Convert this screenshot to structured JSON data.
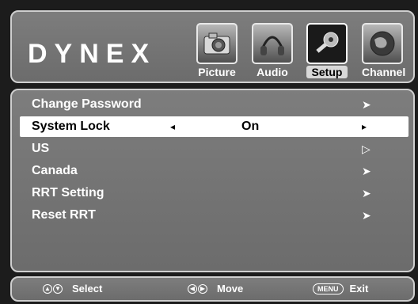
{
  "header": {
    "logo": "DYNEX",
    "tabs": [
      {
        "label": "Picture",
        "icon": "camera-icon",
        "active": false
      },
      {
        "label": "Audio",
        "icon": "headphones-icon",
        "active": false
      },
      {
        "label": "Setup",
        "icon": "tools-icon",
        "active": true
      },
      {
        "label": "Channel",
        "icon": "globe-icon",
        "active": false
      }
    ]
  },
  "menu": {
    "items": [
      {
        "label": "Change Password",
        "arrow": "➤"
      },
      {
        "label": "System Lock",
        "value": "On",
        "left_arrow": "◂",
        "arrow": "▸",
        "selected": true
      },
      {
        "label": "US",
        "arrow": "▷"
      },
      {
        "label": "Canada",
        "arrow": "➤"
      },
      {
        "label": "RRT Setting",
        "arrow": "➤"
      },
      {
        "label": "Reset RRT",
        "arrow": "➤"
      }
    ]
  },
  "footer": {
    "select_label": "Select",
    "move_label": "Move",
    "menu_key": "MENU",
    "exit_label": "Exit"
  },
  "colors": {
    "panel": "#747474",
    "highlight": "#ffffff",
    "text": "#ffffff"
  }
}
